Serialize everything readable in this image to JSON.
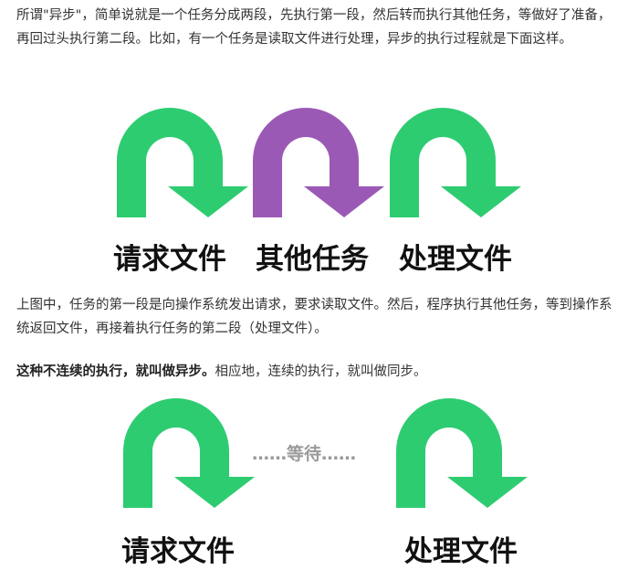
{
  "paragraph1": "所谓\"异步\"，简单说就是一个任务分成两段，先执行第一段，然后转而执行其他任务，等做好了准备，再回过头执行第二段。比如，有一个任务是读取文件进行处理，异步的执行过程就是下面这样。",
  "figure1": {
    "labels": [
      "请求文件",
      "其他任务",
      "处理文件"
    ],
    "colors": [
      "#2ecc71",
      "#9b59b6",
      "#2ecc71"
    ]
  },
  "paragraph2": "上图中，任务的第一段是向操作系统发出请求，要求读取文件。然后，程序执行其他任务，等到操作系统返回文件，再接着执行任务的第二段（处理文件）。",
  "paragraph3": {
    "bold": "这种不连续的执行，就叫做异步。",
    "rest": "相应地，连续的执行，就叫做同步。"
  },
  "figure2": {
    "labels": [
      "请求文件",
      "处理文件"
    ],
    "wait_text": "……等待……",
    "color": "#2ecc71"
  }
}
